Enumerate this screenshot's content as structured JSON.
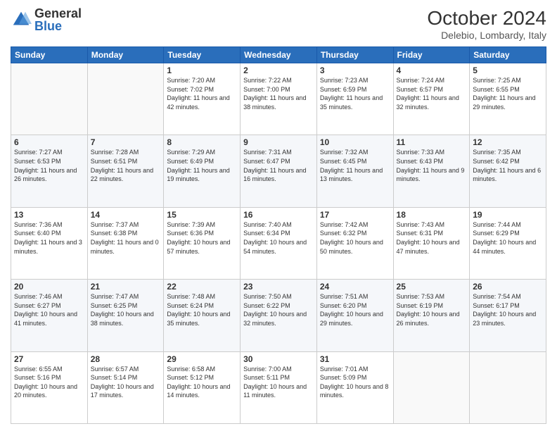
{
  "header": {
    "logo_general": "General",
    "logo_blue": "Blue",
    "month_year": "October 2024",
    "location": "Delebio, Lombardy, Italy"
  },
  "columns": [
    "Sunday",
    "Monday",
    "Tuesday",
    "Wednesday",
    "Thursday",
    "Friday",
    "Saturday"
  ],
  "weeks": [
    [
      {
        "day": "",
        "info": ""
      },
      {
        "day": "",
        "info": ""
      },
      {
        "day": "1",
        "info": "Sunrise: 7:20 AM\nSunset: 7:02 PM\nDaylight: 11 hours and 42 minutes."
      },
      {
        "day": "2",
        "info": "Sunrise: 7:22 AM\nSunset: 7:00 PM\nDaylight: 11 hours and 38 minutes."
      },
      {
        "day": "3",
        "info": "Sunrise: 7:23 AM\nSunset: 6:59 PM\nDaylight: 11 hours and 35 minutes."
      },
      {
        "day": "4",
        "info": "Sunrise: 7:24 AM\nSunset: 6:57 PM\nDaylight: 11 hours and 32 minutes."
      },
      {
        "day": "5",
        "info": "Sunrise: 7:25 AM\nSunset: 6:55 PM\nDaylight: 11 hours and 29 minutes."
      }
    ],
    [
      {
        "day": "6",
        "info": "Sunrise: 7:27 AM\nSunset: 6:53 PM\nDaylight: 11 hours and 26 minutes."
      },
      {
        "day": "7",
        "info": "Sunrise: 7:28 AM\nSunset: 6:51 PM\nDaylight: 11 hours and 22 minutes."
      },
      {
        "day": "8",
        "info": "Sunrise: 7:29 AM\nSunset: 6:49 PM\nDaylight: 11 hours and 19 minutes."
      },
      {
        "day": "9",
        "info": "Sunrise: 7:31 AM\nSunset: 6:47 PM\nDaylight: 11 hours and 16 minutes."
      },
      {
        "day": "10",
        "info": "Sunrise: 7:32 AM\nSunset: 6:45 PM\nDaylight: 11 hours and 13 minutes."
      },
      {
        "day": "11",
        "info": "Sunrise: 7:33 AM\nSunset: 6:43 PM\nDaylight: 11 hours and 9 minutes."
      },
      {
        "day": "12",
        "info": "Sunrise: 7:35 AM\nSunset: 6:42 PM\nDaylight: 11 hours and 6 minutes."
      }
    ],
    [
      {
        "day": "13",
        "info": "Sunrise: 7:36 AM\nSunset: 6:40 PM\nDaylight: 11 hours and 3 minutes."
      },
      {
        "day": "14",
        "info": "Sunrise: 7:37 AM\nSunset: 6:38 PM\nDaylight: 11 hours and 0 minutes."
      },
      {
        "day": "15",
        "info": "Sunrise: 7:39 AM\nSunset: 6:36 PM\nDaylight: 10 hours and 57 minutes."
      },
      {
        "day": "16",
        "info": "Sunrise: 7:40 AM\nSunset: 6:34 PM\nDaylight: 10 hours and 54 minutes."
      },
      {
        "day": "17",
        "info": "Sunrise: 7:42 AM\nSunset: 6:32 PM\nDaylight: 10 hours and 50 minutes."
      },
      {
        "day": "18",
        "info": "Sunrise: 7:43 AM\nSunset: 6:31 PM\nDaylight: 10 hours and 47 minutes."
      },
      {
        "day": "19",
        "info": "Sunrise: 7:44 AM\nSunset: 6:29 PM\nDaylight: 10 hours and 44 minutes."
      }
    ],
    [
      {
        "day": "20",
        "info": "Sunrise: 7:46 AM\nSunset: 6:27 PM\nDaylight: 10 hours and 41 minutes."
      },
      {
        "day": "21",
        "info": "Sunrise: 7:47 AM\nSunset: 6:25 PM\nDaylight: 10 hours and 38 minutes."
      },
      {
        "day": "22",
        "info": "Sunrise: 7:48 AM\nSunset: 6:24 PM\nDaylight: 10 hours and 35 minutes."
      },
      {
        "day": "23",
        "info": "Sunrise: 7:50 AM\nSunset: 6:22 PM\nDaylight: 10 hours and 32 minutes."
      },
      {
        "day": "24",
        "info": "Sunrise: 7:51 AM\nSunset: 6:20 PM\nDaylight: 10 hours and 29 minutes."
      },
      {
        "day": "25",
        "info": "Sunrise: 7:53 AM\nSunset: 6:19 PM\nDaylight: 10 hours and 26 minutes."
      },
      {
        "day": "26",
        "info": "Sunrise: 7:54 AM\nSunset: 6:17 PM\nDaylight: 10 hours and 23 minutes."
      }
    ],
    [
      {
        "day": "27",
        "info": "Sunrise: 6:55 AM\nSunset: 5:16 PM\nDaylight: 10 hours and 20 minutes."
      },
      {
        "day": "28",
        "info": "Sunrise: 6:57 AM\nSunset: 5:14 PM\nDaylight: 10 hours and 17 minutes."
      },
      {
        "day": "29",
        "info": "Sunrise: 6:58 AM\nSunset: 5:12 PM\nDaylight: 10 hours and 14 minutes."
      },
      {
        "day": "30",
        "info": "Sunrise: 7:00 AM\nSunset: 5:11 PM\nDaylight: 10 hours and 11 minutes."
      },
      {
        "day": "31",
        "info": "Sunrise: 7:01 AM\nSunset: 5:09 PM\nDaylight: 10 hours and 8 minutes."
      },
      {
        "day": "",
        "info": ""
      },
      {
        "day": "",
        "info": ""
      }
    ]
  ]
}
